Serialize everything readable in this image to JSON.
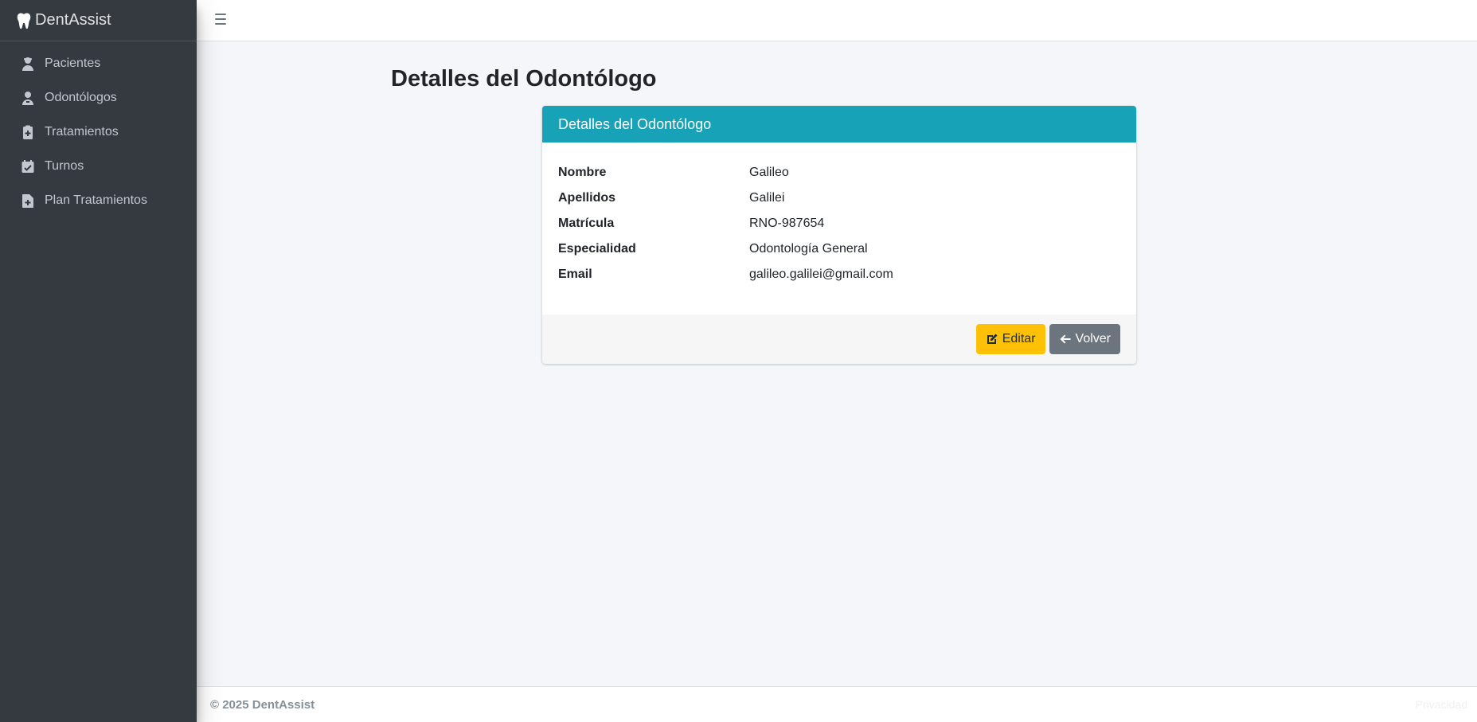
{
  "app": {
    "brand": "DentAssist"
  },
  "sidebar": {
    "items": [
      {
        "label": "Pacientes",
        "icon": "user-doctor-icon"
      },
      {
        "label": "Odontólogos",
        "icon": "user-md-icon"
      },
      {
        "label": "Tratamientos",
        "icon": "clipboard-medical-icon"
      },
      {
        "label": "Turnos",
        "icon": "calendar-check-icon"
      },
      {
        "label": "Plan Tratamientos",
        "icon": "file-medical-icon"
      }
    ]
  },
  "page": {
    "title": "Detalles del Odontólogo"
  },
  "card": {
    "header": "Detalles del Odontólogo",
    "fields": [
      {
        "label": "Nombre",
        "value": "Galileo"
      },
      {
        "label": "Apellidos",
        "value": "Galilei"
      },
      {
        "label": "Matrícula",
        "value": "RNO-987654"
      },
      {
        "label": "Especialidad",
        "value": "Odontología General"
      },
      {
        "label": "Email",
        "value": "galileo.galilei@gmail.com"
      }
    ],
    "edit_label": "Editar",
    "back_label": "Volver"
  },
  "footer": {
    "copyright": "© 2025 DentAssist",
    "right_text": "Privacidad"
  },
  "colors": {
    "sidebar": "#343a40",
    "card_header": "#17a2b8",
    "warning": "#ffc107",
    "secondary": "#6c757d"
  }
}
